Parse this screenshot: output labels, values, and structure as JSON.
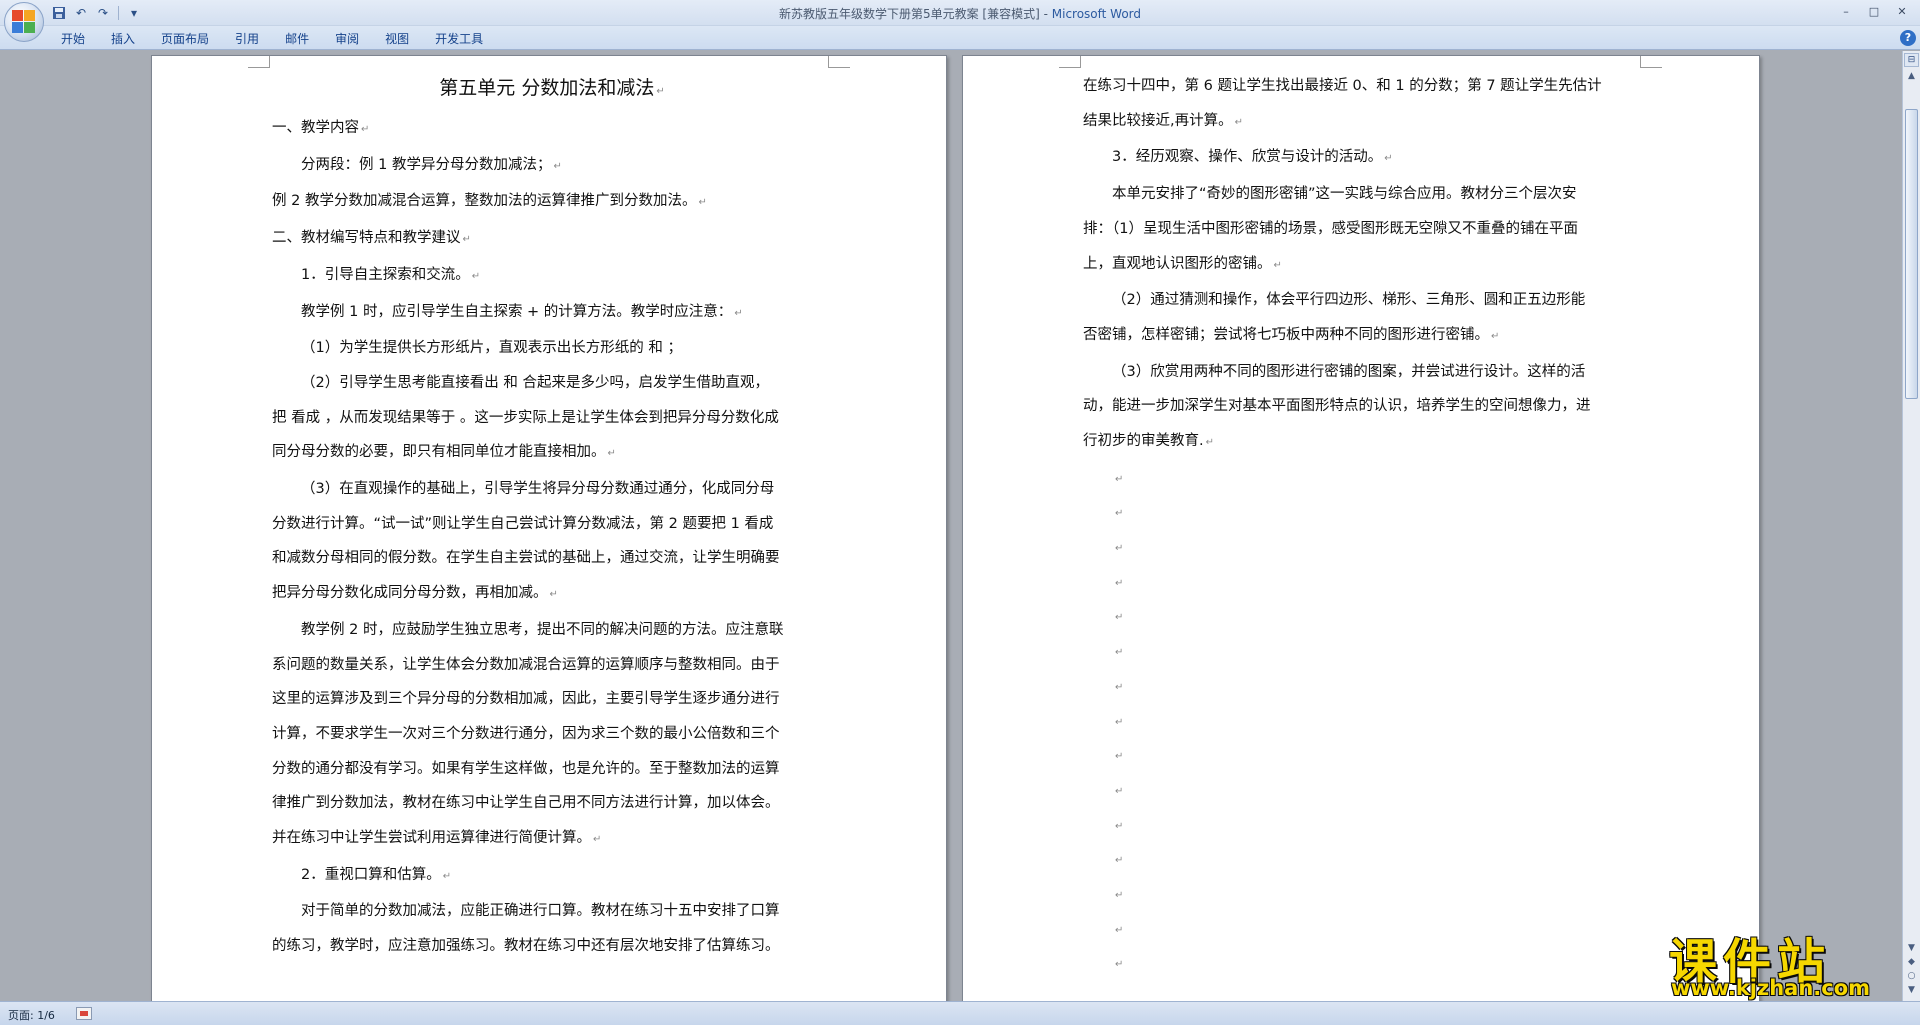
{
  "window": {
    "title_doc": "新苏教版五年级数学下册第5单元教案 [兼容模式] - ",
    "title_app": "Microsoft Word"
  },
  "qat": {
    "save_icon": "save-icon",
    "undo_icon": "undo-icon",
    "redo_icon": "redo-icon",
    "customize_icon": "customize-icon"
  },
  "ribbon": {
    "tabs": [
      "开始",
      "插入",
      "页面布局",
      "引用",
      "邮件",
      "审阅",
      "视图",
      "开发工具"
    ]
  },
  "pages": {
    "left": {
      "title": "第五单元  分数加法和减法",
      "lines": [
        {
          "text": "一、教学内容",
          "indent": false,
          "mark": true
        },
        {
          "text": "分两段：例 1 教学异分母分数加减法；",
          "indent": true,
          "mark": true
        },
        {
          "text": "例 2 教学分数加减混合运算，整数加法的运算律推广到分数加法。",
          "indent": false,
          "mark": true
        },
        {
          "text": "二、教材编写特点和教学建议",
          "indent": false,
          "mark": true
        },
        {
          "text": "1．引导自主探索和交流。",
          "indent": true,
          "mark": true
        },
        {
          "text": "教学例 1 时，应引导学生自主探索 + 的计算方法。教学时应注意：",
          "indent": true,
          "mark": true
        },
        {
          "text": "（1）为学生提供长方形纸片，直观表示出长方形纸的 和 ；",
          "indent": true,
          "mark": false
        },
        {
          "text": "（2）引导学生思考能直接看出 和 合起来是多少吗，启发学生借助直观，",
          "indent": true,
          "mark": false
        },
        {
          "text": "把 看成 ，从而发现结果等于 。这一步实际上是让学生体会到把异分母分数化成",
          "indent": false,
          "mark": false
        },
        {
          "text": "同分母分数的必要，即只有相同单位才能直接相加。",
          "indent": false,
          "mark": true
        },
        {
          "text": "（3）在直观操作的基础上，引导学生将异分母分数通过通分，化成同分母",
          "indent": true,
          "mark": false
        },
        {
          "text": "分数进行计算。“试一试”则让学生自己尝试计算分数减法，第 2 题要把 1 看成",
          "indent": false,
          "mark": false
        },
        {
          "text": "和减数分母相同的假分数。在学生自主尝试的基础上，通过交流，让学生明确要",
          "indent": false,
          "mark": false
        },
        {
          "text": "把异分母分数化成同分母分数，再相加减。",
          "indent": false,
          "mark": true
        },
        {
          "text": "教学例 2 时，应鼓励学生独立思考，提出不同的解决问题的方法。应注意联",
          "indent": true,
          "mark": false
        },
        {
          "text": "系问题的数量关系，让学生体会分数加减混合运算的运算顺序与整数相同。由于",
          "indent": false,
          "mark": false
        },
        {
          "text": "这里的运算涉及到三个异分母的分数相加减，因此，主要引导学生逐步通分进行",
          "indent": false,
          "mark": false
        },
        {
          "text": "计算，不要求学生一次对三个分数进行通分，因为求三个数的最小公倍数和三个",
          "indent": false,
          "mark": false
        },
        {
          "text": "分数的通分都没有学习。如果有学生这样做，也是允许的。至于整数加法的运算",
          "indent": false,
          "mark": false
        },
        {
          "text": "律推广到分数加法，教材在练习中让学生自己用不同方法进行计算，加以体会。",
          "indent": false,
          "mark": false
        },
        {
          "text": "并在练习中让学生尝试利用运算律进行简便计算。",
          "indent": false,
          "mark": true
        },
        {
          "text": "2．重视口算和估算。",
          "indent": true,
          "mark": true
        },
        {
          "text": "对于简单的分数加减法，应能正确进行口算。教材在练习十五中安排了口算",
          "indent": true,
          "mark": false
        },
        {
          "text": "的练习，教学时，应注意加强练习。教材在练习中还有层次地安排了估算练习。",
          "indent": false,
          "mark": false
        }
      ]
    },
    "right": {
      "lines": [
        {
          "text": "在练习十四中，第 6 题让学生找出最接近 0、和 1 的分数；第 7 题让学生先估计",
          "indent": false,
          "mark": false
        },
        {
          "text": "结果比较接近,再计算。",
          "indent": false,
          "mark": true
        },
        {
          "text": "3．经历观察、操作、欣赏与设计的活动。",
          "indent": true,
          "mark": true
        },
        {
          "text": "本单元安排了“奇妙的图形密铺”这一实践与综合应用。教材分三个层次安",
          "indent": true,
          "mark": false
        },
        {
          "text": "排：（1）呈现生活中图形密铺的场景，感受图形既无空隙又不重叠的铺在平面",
          "indent": false,
          "mark": false
        },
        {
          "text": "上，直观地认识图形的密铺。",
          "indent": false,
          "mark": true
        },
        {
          "text": "（2）通过猜测和操作，体会平行四边形、梯形、三角形、圆和正五边形能",
          "indent": true,
          "mark": false
        },
        {
          "text": "否密铺，怎样密铺；尝试将七巧板中两种不同的图形进行密铺。",
          "indent": false,
          "mark": true
        },
        {
          "text": "（3）欣赏用两种不同的图形进行密铺的图案，并尝试进行设计。这样的活",
          "indent": true,
          "mark": false
        },
        {
          "text": "动，能进一步加深学生对基本平面图形特点的认识，培养学生的空间想像力，进",
          "indent": false,
          "mark": false
        },
        {
          "text": "行初步的审美教育.",
          "indent": false,
          "mark": true
        }
      ],
      "empty_paragraphs": 15
    },
    "paragraph_mark": "↵"
  },
  "status": {
    "page_label": "页面: 1/6"
  },
  "watermark": {
    "main": "课件站",
    "url": "www.kjzhan.com"
  },
  "colors": {
    "title_app": "#2c5aa0",
    "ribbon_text": "#15428b",
    "watermark": "#f6d700"
  }
}
